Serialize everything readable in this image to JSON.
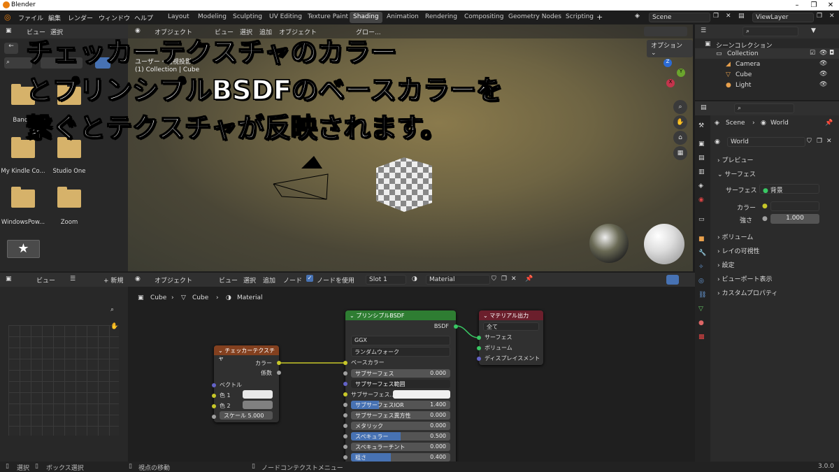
{
  "window": {
    "title": "Blender"
  },
  "menu": {
    "items": [
      "ファイル",
      "編集",
      "レンダー",
      "ウィンドウ",
      "ヘルプ"
    ]
  },
  "workspaces": [
    "Layout",
    "Modeling",
    "Sculpting",
    "UV Editing",
    "Texture Paint",
    "Shading",
    "Animation",
    "Rendering",
    "Compositing",
    "Geometry Nodes",
    "Scripting"
  ],
  "active_workspace": "Shading",
  "scene": {
    "label": "Scene"
  },
  "viewlayer": {
    "label": "ViewLayer"
  },
  "filebrowser": {
    "header": [
      "ビュー",
      "選択"
    ],
    "folders": [
      "Banc...",
      "My Kindle Co...",
      "Studio One",
      "WindowsPow...",
      "Zoom"
    ]
  },
  "viewport": {
    "header": [
      "オブジェクト",
      "ビュー",
      "選択",
      "追加",
      "オブジェクト"
    ],
    "global": "グロー...",
    "option": "オプション",
    "view_name": "ユーザー・透視投影",
    "collection_info": "(1) Collection | Cube"
  },
  "overlay_caption": [
    "チェッカーテクスチャのカラー",
    "とプリンシプルBSDFのベースカラーを",
    "繋ぐとテクスチャが反映されます。"
  ],
  "outliner": {
    "title": "シーンコレクション",
    "items": [
      "Collection",
      "Camera",
      "Cube",
      "Light"
    ]
  },
  "properties": {
    "breadcrumb": [
      "Scene",
      "World"
    ],
    "world": "World",
    "sections": [
      "プレビュー",
      "サーフェス",
      "ボリューム",
      "レイの可視性",
      "設定",
      "ビューポート表示",
      "カスタムプロパティ"
    ],
    "surface_label": "サーフェス",
    "surface_value": "背景",
    "color_label": "カラー",
    "strength_label": "強さ",
    "strength_value": "1.000"
  },
  "node_editor": {
    "header": [
      "オブジェクト",
      "ビュー",
      "選択",
      "追加",
      "ノード"
    ],
    "use_nodes": "ノードを使用",
    "slot": "Slot 1",
    "material": "Material",
    "breadcrumb": [
      "Cube",
      "Cube",
      "Material"
    ],
    "left_header": [
      "ビュー"
    ],
    "new_label": "新規"
  },
  "checker_node": {
    "title": "チェッカーテクスチャ",
    "outputs": [
      "カラー",
      "係数"
    ],
    "inputs": [
      "ベクトル",
      "色 1",
      "色 2"
    ],
    "scale_label": "スケール",
    "scale_value": "5.000"
  },
  "bsdf_node": {
    "title": "プリンシプルBSDF",
    "output": "BSDF",
    "distribution": "GGX",
    "subsurface_method": "ランダムウォーク",
    "base_color": "ベースカラー",
    "rows": [
      {
        "label": "サブサーフェス",
        "value": "0.000",
        "fill": 0
      },
      {
        "label": "サブサーフェス範囲",
        "value": "",
        "fill": 0,
        "dropdown": true
      },
      {
        "label": "サブサーフェス...",
        "value": "",
        "fill": 0,
        "color": true
      },
      {
        "label": "サブサーフェスIOR",
        "value": "1.400",
        "fill": 0.28
      },
      {
        "label": "サブサーフェス異方性",
        "value": "0.000",
        "fill": 0
      },
      {
        "label": "メタリック",
        "value": "0.000",
        "fill": 0
      },
      {
        "label": "スペキュラー",
        "value": "0.500",
        "fill": 0.5
      },
      {
        "label": "スペキュラーチント",
        "value": "0.000",
        "fill": 0
      },
      {
        "label": "粗さ",
        "value": "0.400",
        "fill": 0.4
      }
    ]
  },
  "output_node": {
    "title": "マテリアル出力",
    "target": "全て",
    "inputs": [
      "サーフェス",
      "ボリューム",
      "ディスプレイスメント"
    ]
  },
  "status": {
    "select": "選択",
    "box_select": "ボックス選択",
    "move_view": "視点の移動",
    "node_context": "ノードコンテクストメニュー",
    "version": "3.0.0"
  },
  "colors": {
    "checker_header": "#83401f",
    "bsdf_header": "#2e7d32",
    "output_header": "#6b1f2c",
    "accent": "#4772b3",
    "socket_yellow": "#c7c729",
    "socket_green": "#39c864",
    "socket_grey": "#a1a1a1",
    "socket_purple": "#6363c7"
  }
}
